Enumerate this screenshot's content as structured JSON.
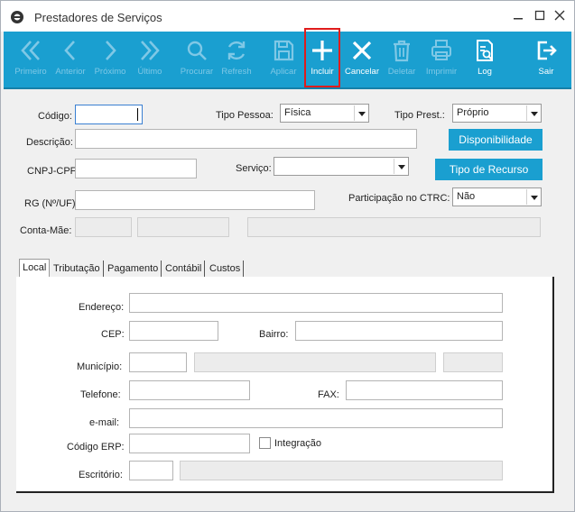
{
  "window": {
    "title": "Prestadores de Serviços"
  },
  "toolbar": {
    "primeiro": "Primeiro",
    "anterior": "Anterior",
    "proximo": "Próximo",
    "ultimo": "Último",
    "procurar": "Procurar",
    "refresh": "Refresh",
    "aplicar": "Aplicar",
    "incluir": "Incluir",
    "cancelar": "Cancelar",
    "deletar": "Deletar",
    "imprimir": "Imprimir",
    "log": "Log",
    "sair": "Sair"
  },
  "form": {
    "codigo_label": "Código:",
    "codigo_value": "",
    "tipo_pessoa_label": "Tipo Pessoa:",
    "tipo_pessoa_value": "Física",
    "tipo_prest_label": "Tipo Prest.:",
    "tipo_prest_value": "Próprio",
    "descricao_label": "Descrição:",
    "disponibilidade_button": "Disponibilidade",
    "cnpj_label": "CNPJ-CPF",
    "servico_label": "Serviço:",
    "servico_value": "",
    "tipo_recurso_button": "Tipo de Recurso",
    "rg_label": "RG (Nº/UF)",
    "participacao_label": "Participação no CTRC:",
    "participacao_value": "Não",
    "conta_mae_label": "Conta-Mãe:"
  },
  "tabs": [
    "Local",
    "Tributação",
    "Pagamento",
    "Contábil",
    "Custos"
  ],
  "local": {
    "endereco_label": "Endereço:",
    "cep_label": "CEP:",
    "bairro_label": "Bairro:",
    "municipio_label": "Município:",
    "telefone_label": "Telefone:",
    "fax_label": "FAX:",
    "email_label": "e-mail:",
    "codigo_erp_label": "Código ERP:",
    "integracao_label": "Integração",
    "integracao_checked": false,
    "escritorio_label": "Escritório:"
  },
  "colors": {
    "toolbar": "#1a9fd0",
    "highlight": "#e01c1c",
    "button": "#1a9fd0"
  }
}
